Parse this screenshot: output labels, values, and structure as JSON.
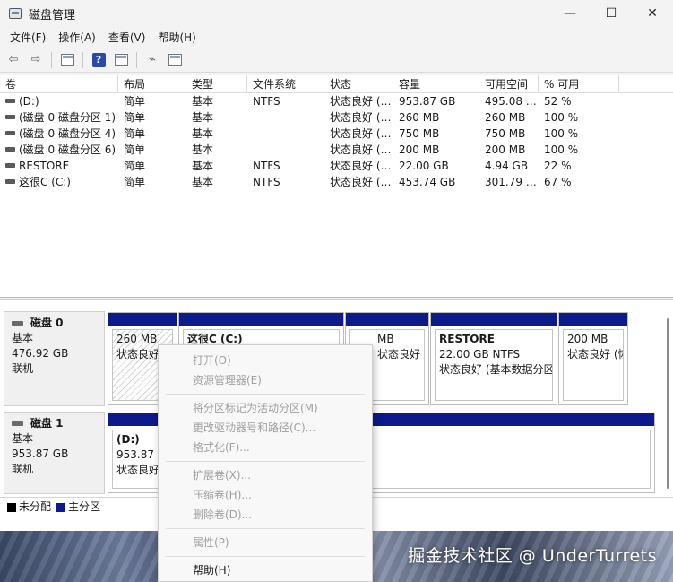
{
  "window": {
    "title": "磁盘管理",
    "controls": {
      "minimize": "—",
      "maximize": "☐",
      "close": "✕"
    }
  },
  "menubar": [
    "文件(F)",
    "操作(A)",
    "查看(V)",
    "帮助(H)"
  ],
  "toolbar": [
    "back-icon",
    "forward-icon",
    "properties-icon",
    "help-icon",
    "view-icon",
    "connect-icon",
    "settings-icon"
  ],
  "volume_table": {
    "headers": [
      "卷",
      "布局",
      "类型",
      "文件系统",
      "状态",
      "容量",
      "可用空间",
      "% 可用"
    ],
    "rows": [
      [
        "(D:)",
        "简单",
        "基本",
        "NTFS",
        "状态良好 (…",
        "953.87 GB",
        "495.08 …",
        "52 %"
      ],
      [
        "(磁盘 0 磁盘分区 1)",
        "简单",
        "基本",
        "",
        "状态良好 (…",
        "260 MB",
        "260 MB",
        "100 %"
      ],
      [
        "(磁盘 0 磁盘分区 4)",
        "简单",
        "基本",
        "",
        "状态良好 (…",
        "750 MB",
        "750 MB",
        "100 %"
      ],
      [
        "(磁盘 0 磁盘分区 6)",
        "简单",
        "基本",
        "",
        "状态良好 (…",
        "200 MB",
        "200 MB",
        "100 %"
      ],
      [
        "RESTORE",
        "简单",
        "基本",
        "NTFS",
        "状态良好 (…",
        "22.00 GB",
        "4.94 GB",
        "22 %"
      ],
      [
        "这很C (C:)",
        "简单",
        "基本",
        "NTFS",
        "状态良好 (…",
        "453.74 GB",
        "301.79 …",
        "67 %"
      ]
    ]
  },
  "disks": [
    {
      "name": "磁盘 0",
      "type": "基本",
      "size": "476.92 GB",
      "status": "联机",
      "partitions": [
        {
          "name": "",
          "line1": "260 MB",
          "line2": "状态良好"
        },
        {
          "name": "这很C  (C:)",
          "line1": "",
          "line2": ""
        },
        {
          "name": "",
          "line1": "MB",
          "line2": "状态良好 (恢"
        },
        {
          "name": "RESTORE",
          "line1": "22.00 GB NTFS",
          "line2": "状态良好 (基本数据分区"
        },
        {
          "name": "",
          "line1": "200 MB",
          "line2": "状态良好 (恢"
        }
      ]
    },
    {
      "name": "磁盘 1",
      "type": "基本",
      "size": "953.87 GB",
      "status": "联机",
      "partitions": [
        {
          "name": "(D:)",
          "line1": "953.87 G",
          "line2": "状态良好"
        }
      ]
    }
  ],
  "legend": [
    {
      "label": "未分配",
      "color": "#000000"
    },
    {
      "label": "主分区",
      "color": "#0d1a8a"
    }
  ],
  "context_menu": [
    {
      "label": "打开(O)",
      "enabled": false
    },
    {
      "label": "资源管理器(E)",
      "enabled": false
    },
    {
      "sep": true
    },
    {
      "label": "将分区标记为活动分区(M)",
      "enabled": false
    },
    {
      "label": "更改驱动器号和路径(C)...",
      "enabled": false
    },
    {
      "label": "格式化(F)...",
      "enabled": false
    },
    {
      "sep": true
    },
    {
      "label": "扩展卷(X)...",
      "enabled": false
    },
    {
      "label": "压缩卷(H)...",
      "enabled": false
    },
    {
      "label": "删除卷(D)...",
      "enabled": false
    },
    {
      "sep": true
    },
    {
      "label": "属性(P)",
      "enabled": false
    },
    {
      "sep": true
    },
    {
      "label": "帮助(H)",
      "enabled": true
    }
  ],
  "watermark": "掘金技术社区 @ UnderTurrets"
}
